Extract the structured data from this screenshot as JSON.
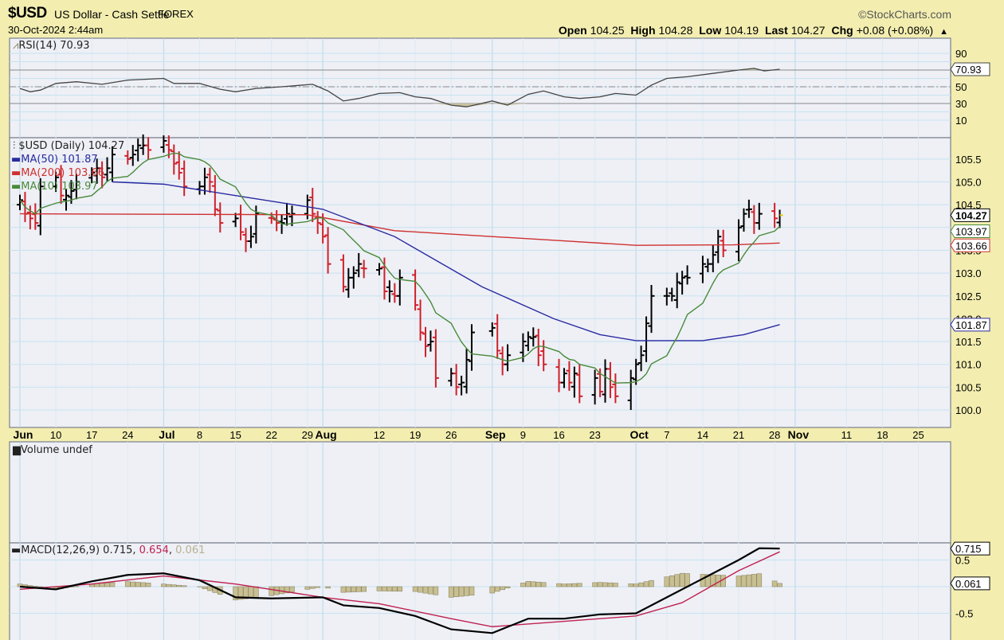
{
  "header": {
    "symbol": "$USD",
    "name": "US Dollar - Cash Settle",
    "exchange": "FOREX",
    "datetime": "30-Oct-2024 2:44am",
    "copyright": "©StockCharts.com",
    "open_label": "Open",
    "open": "104.25",
    "high_label": "High",
    "high": "104.28",
    "low_label": "Low",
    "low": "104.19",
    "last_label": "Last",
    "last": "104.27",
    "chg_label": "Chg",
    "chg": "+0.08 (+0.08%)",
    "chg_arrow": "▲"
  },
  "colors": {
    "up": "#000000",
    "down": "#d0202a",
    "ma50": "#2a2aa0",
    "ma200": "#d03030",
    "ma10": "#4a8a3a",
    "macd": "#000000",
    "signal": "#c02050",
    "hist": "#c8bf92",
    "grid": "#c6e2f0"
  },
  "legends": {
    "rsi": "RSI(14) 70.93",
    "price": "$USD (Daily) 104.27",
    "ma50": "MA(50) 101.87",
    "ma200": "MA(200) 103.66",
    "ma10": "MA(10) 103.97",
    "volume": "Volume undef",
    "macd_name": "MACD(12,26,9)",
    "macd_val": "0.715",
    "signal_val": "0.654",
    "hist_val": "0.061"
  },
  "chart_data": {
    "type": "line",
    "title": "$USD US Dollar - Cash Settle FOREX (Daily)",
    "year": 2024,
    "x_ticks": [
      {
        "label": "Jun",
        "date": "06-03",
        "month": true
      },
      {
        "label": "10",
        "date": "06-10"
      },
      {
        "label": "17",
        "date": "06-17"
      },
      {
        "label": "24",
        "date": "06-24"
      },
      {
        "label": "Jul",
        "date": "07-01",
        "month": true
      },
      {
        "label": "8",
        "date": "07-08"
      },
      {
        "label": "15",
        "date": "07-15"
      },
      {
        "label": "22",
        "date": "07-22"
      },
      {
        "label": "29",
        "date": "07-29"
      },
      {
        "label": "Aug",
        "date": "08-01",
        "month": true
      },
      {
        "label": "12",
        "date": "08-12"
      },
      {
        "label": "19",
        "date": "08-19"
      },
      {
        "label": "26",
        "date": "08-26"
      },
      {
        "label": "Sep",
        "date": "09-03",
        "month": true
      },
      {
        "label": "9",
        "date": "09-09"
      },
      {
        "label": "16",
        "date": "09-16"
      },
      {
        "label": "23",
        "date": "09-23"
      },
      {
        "label": "Oct",
        "date": "10-01",
        "month": true
      },
      {
        "label": "7",
        "date": "10-07"
      },
      {
        "label": "14",
        "date": "10-14"
      },
      {
        "label": "21",
        "date": "10-21"
      },
      {
        "label": "28",
        "date": "10-28"
      },
      {
        "label": "Nov",
        "date": "11-01",
        "month": true
      },
      {
        "label": "11",
        "date": "11-11"
      },
      {
        "label": "18",
        "date": "11-18"
      },
      {
        "label": "25",
        "date": "11-25"
      }
    ],
    "price": {
      "ylim": [
        99.75,
        106.0
      ],
      "y_ticks": [
        "100.0",
        "100.5",
        "101.0",
        "101.5",
        "102.0",
        "102.5",
        "103.0",
        "103.5",
        "104.0",
        "104.5",
        "105.0",
        "105.5"
      ],
      "dates": [
        "06-03",
        "06-04",
        "06-05",
        "06-06",
        "06-07",
        "06-10",
        "06-11",
        "06-12",
        "06-13",
        "06-14",
        "06-17",
        "06-18",
        "06-19",
        "06-20",
        "06-21",
        "06-24",
        "06-25",
        "06-26",
        "06-27",
        "06-28",
        "07-01",
        "07-02",
        "07-03",
        "07-04",
        "07-05",
        "07-08",
        "07-09",
        "07-10",
        "07-11",
        "07-12",
        "07-15",
        "07-16",
        "07-17",
        "07-18",
        "07-19",
        "07-22",
        "07-23",
        "07-24",
        "07-25",
        "07-26",
        "07-29",
        "07-30",
        "07-31",
        "08-01",
        "08-02",
        "08-05",
        "08-06",
        "08-07",
        "08-08",
        "08-09",
        "08-12",
        "08-13",
        "08-14",
        "08-15",
        "08-16",
        "08-19",
        "08-20",
        "08-21",
        "08-22",
        "08-23",
        "08-26",
        "08-27",
        "08-28",
        "08-29",
        "08-30",
        "09-03",
        "09-04",
        "09-05",
        "09-06",
        "09-09",
        "09-10",
        "09-11",
        "09-12",
        "09-13",
        "09-16",
        "09-17",
        "09-18",
        "09-19",
        "09-20",
        "09-23",
        "09-24",
        "09-25",
        "09-26",
        "09-27",
        "09-30",
        "10-01",
        "10-02",
        "10-03",
        "10-04",
        "10-07",
        "10-08",
        "10-09",
        "10-10",
        "10-11",
        "10-14",
        "10-15",
        "10-16",
        "10-17",
        "10-18",
        "10-21",
        "10-22",
        "10-23",
        "10-24",
        "10-25",
        "10-28",
        "10-29"
      ],
      "close": [
        104.6,
        104.3,
        104.2,
        104.1,
        104.9,
        105.1,
        104.7,
        104.7,
        104.8,
        105.0,
        105.2,
        105.3,
        105.1,
        105.3,
        105.6,
        105.5,
        105.6,
        105.8,
        105.8,
        105.7,
        105.9,
        105.7,
        105.4,
        105.2,
        104.9,
        104.9,
        105.1,
        105.0,
        104.4,
        104.1,
        104.2,
        103.9,
        103.7,
        103.8,
        104.3,
        104.2,
        104.1,
        104.1,
        104.3,
        104.3,
        104.6,
        104.3,
        104.1,
        103.8,
        103.2,
        102.7,
        102.9,
        103.0,
        103.2,
        103.1,
        103.1,
        102.6,
        102.6,
        102.5,
        102.9,
        102.3,
        101.7,
        101.4,
        101.5,
        100.7,
        100.8,
        100.5,
        100.6,
        101.1,
        101.7,
        101.8,
        101.3,
        101.0,
        101.2,
        101.5,
        101.6,
        101.6,
        101.2,
        101.0,
        100.6,
        100.8,
        100.6,
        100.8,
        100.3,
        100.7,
        100.4,
        100.9,
        100.5,
        100.3,
        100.7,
        101.0,
        101.2,
        101.9,
        102.5,
        102.5,
        102.5,
        102.8,
        102.9,
        102.9,
        103.2,
        103.2,
        103.4,
        103.8,
        103.5,
        104.0,
        104.3,
        104.4,
        104.1,
        104.3,
        104.2,
        104.27
      ],
      "ma50": [
        [
          "06-21",
          105.0
        ],
        [
          "07-01",
          104.95
        ],
        [
          "07-15",
          104.7
        ],
        [
          "08-01",
          104.4
        ],
        [
          "08-15",
          103.8
        ],
        [
          "09-01",
          102.7
        ],
        [
          "09-15",
          102.0
        ],
        [
          "09-24",
          101.65
        ],
        [
          "10-01",
          101.52
        ],
        [
          "10-14",
          101.52
        ],
        [
          "10-22",
          101.65
        ],
        [
          "10-29",
          101.87
        ]
      ],
      "ma200": [
        [
          "06-03",
          104.3
        ],
        [
          "07-29",
          104.28
        ],
        [
          "08-15",
          103.93
        ],
        [
          "09-15",
          103.72
        ],
        [
          "10-01",
          103.61
        ],
        [
          "10-20",
          103.62
        ],
        [
          "10-29",
          103.66
        ]
      ],
      "last_labels": [
        "104.27",
        "103.97",
        "103.66",
        "101.87"
      ]
    },
    "rsi": {
      "ylim": [
        0,
        100
      ],
      "y_ticks": [
        "10",
        "30",
        "50",
        "90"
      ],
      "levels": [
        70,
        50,
        30
      ],
      "last": "70.93",
      "points": [
        [
          "06-03",
          48
        ],
        [
          "06-05",
          44
        ],
        [
          "06-07",
          46
        ],
        [
          "06-10",
          54
        ],
        [
          "06-14",
          56
        ],
        [
          "06-19",
          53
        ],
        [
          "06-24",
          58
        ],
        [
          "07-01",
          60
        ],
        [
          "07-03",
          54
        ],
        [
          "07-08",
          54
        ],
        [
          "07-12",
          47
        ],
        [
          "07-15",
          44
        ],
        [
          "07-19",
          48
        ],
        [
          "07-24",
          50
        ],
        [
          "07-30",
          53
        ],
        [
          "08-02",
          45
        ],
        [
          "08-05",
          33
        ],
        [
          "08-08",
          36
        ],
        [
          "08-12",
          42
        ],
        [
          "08-16",
          43
        ],
        [
          "08-19",
          38
        ],
        [
          "08-22",
          36
        ],
        [
          "08-26",
          28
        ],
        [
          "08-29",
          26
        ],
        [
          "09-03",
          33
        ],
        [
          "09-06",
          28
        ],
        [
          "09-10",
          41
        ],
        [
          "09-13",
          45
        ],
        [
          "09-17",
          38
        ],
        [
          "09-20",
          36
        ],
        [
          "09-24",
          38
        ],
        [
          "09-27",
          42
        ],
        [
          "10-01",
          40
        ],
        [
          "10-04",
          52
        ],
        [
          "10-07",
          60
        ],
        [
          "10-11",
          62
        ],
        [
          "10-16",
          66
        ],
        [
          "10-21",
          70
        ],
        [
          "10-24",
          72
        ],
        [
          "10-26",
          69
        ],
        [
          "10-29",
          70.93
        ]
      ]
    },
    "macd": {
      "ylim": [
        -1.0,
        1.0
      ],
      "y_ticks": [
        "0.5",
        "-0.5"
      ],
      "last_labels": [
        "0.715",
        "0.061"
      ],
      "macd": [
        [
          "06-03",
          0.0
        ],
        [
          "06-10",
          -0.05
        ],
        [
          "06-17",
          0.1
        ],
        [
          "06-24",
          0.22
        ],
        [
          "07-01",
          0.25
        ],
        [
          "07-08",
          0.12
        ],
        [
          "07-15",
          -0.2
        ],
        [
          "07-22",
          -0.22
        ],
        [
          "08-01",
          -0.2
        ],
        [
          "08-05",
          -0.35
        ],
        [
          "08-12",
          -0.4
        ],
        [
          "08-19",
          -0.55
        ],
        [
          "08-26",
          -0.8
        ],
        [
          "09-03",
          -0.87
        ],
        [
          "09-10",
          -0.6
        ],
        [
          "09-17",
          -0.6
        ],
        [
          "09-24",
          -0.52
        ],
        [
          "10-01",
          -0.5
        ],
        [
          "10-07",
          -0.2
        ],
        [
          "10-14",
          0.15
        ],
        [
          "10-21",
          0.5
        ],
        [
          "10-25",
          0.72
        ],
        [
          "10-29",
          0.715
        ]
      ],
      "signal": [
        [
          "06-03",
          -0.05
        ],
        [
          "06-17",
          0.05
        ],
        [
          "07-01",
          0.2
        ],
        [
          "07-15",
          0.05
        ],
        [
          "08-01",
          -0.2
        ],
        [
          "08-12",
          -0.32
        ],
        [
          "08-26",
          -0.6
        ],
        [
          "09-03",
          -0.75
        ],
        [
          "09-17",
          -0.65
        ],
        [
          "10-01",
          -0.55
        ],
        [
          "10-10",
          -0.3
        ],
        [
          "10-21",
          0.3
        ],
        [
          "10-29",
          0.654
        ]
      ]
    }
  }
}
